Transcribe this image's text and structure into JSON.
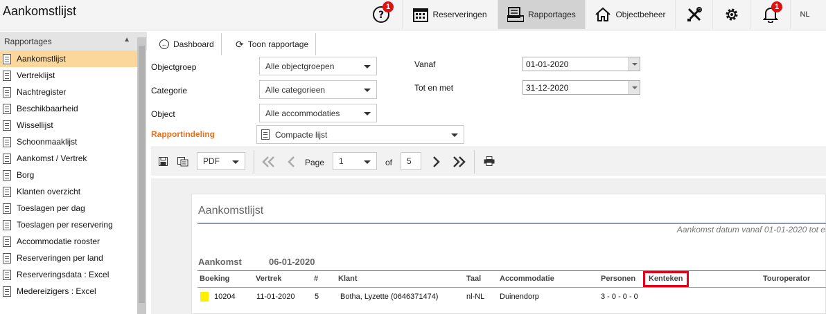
{
  "header": {
    "app_title": "Aankomstlijst",
    "help_badge": "1",
    "nav": [
      {
        "label": "Reserveringen",
        "icon": "calendar-icon"
      },
      {
        "label": "Rapportages",
        "icon": "report-icon",
        "active": true
      },
      {
        "label": "Objectbeheer",
        "icon": "house-icon"
      }
    ],
    "notifications_badge": "1",
    "language": "NL"
  },
  "sidebar": {
    "title": "Rapportages",
    "items": [
      {
        "label": "Aankomstlijst",
        "active": true
      },
      {
        "label": "Vertreklijst"
      },
      {
        "label": "Nachtregister"
      },
      {
        "label": "Beschikbaarheid"
      },
      {
        "label": "Wissellijst"
      },
      {
        "label": "Schoonmaaklijst"
      },
      {
        "label": "Aankomst / Vertrek"
      },
      {
        "label": "Borg"
      },
      {
        "label": "Klanten overzicht"
      },
      {
        "label": "Toeslagen per dag"
      },
      {
        "label": "Toeslagen per reservering"
      },
      {
        "label": "Accommodatie rooster"
      },
      {
        "label": "Reserveringen per land"
      },
      {
        "label": "Reserveringsdata : Excel"
      },
      {
        "label": "Medereizigers : Excel"
      }
    ]
  },
  "toolbar": {
    "dashboard_label": "Dashboard",
    "show_report_label": "Toon rapportage"
  },
  "filters": {
    "objectgroep_label": "Objectgroep",
    "objectgroep_value": "Alle objectgroepen",
    "categorie_label": "Categorie",
    "categorie_value": "Alle categorieen",
    "object_label": "Object",
    "object_value": "Alle accommodaties",
    "indeling_label": "Rapportindeling",
    "indeling_value": "Compacte lijst",
    "vanaf_label": "Vanaf",
    "vanaf_value": "01-01-2020",
    "totenmet_label": "Tot en met",
    "totenmet_value": "31-12-2020"
  },
  "viewer": {
    "format": "PDF",
    "page_label": "Page",
    "page_value": "1",
    "of_label": "of",
    "total_pages": "5"
  },
  "report": {
    "title": "Aankomstlijst",
    "subtitle": "Aankomst datum vanaf 01-01-2020 tot e",
    "arrival_label": "Aankomst",
    "arrival_date": "06-01-2020",
    "columns": [
      "Boeking",
      "Vertrek",
      "#",
      "Klant",
      "Taal",
      "Accommodatie",
      "Personen",
      "Kenteken",
      "Touroperator"
    ],
    "rows": [
      {
        "boeking": "10204",
        "vertrek": "11-01-2020",
        "nr": "5",
        "klant": "Botha, Lyzette (0646371474)",
        "taal": "nl-NL",
        "accommodatie": "Duinendorp",
        "personen": "3 - 0 - 0 - 0",
        "marker_color": "#ffef00"
      }
    ],
    "highlight_color": "#e2001a"
  }
}
